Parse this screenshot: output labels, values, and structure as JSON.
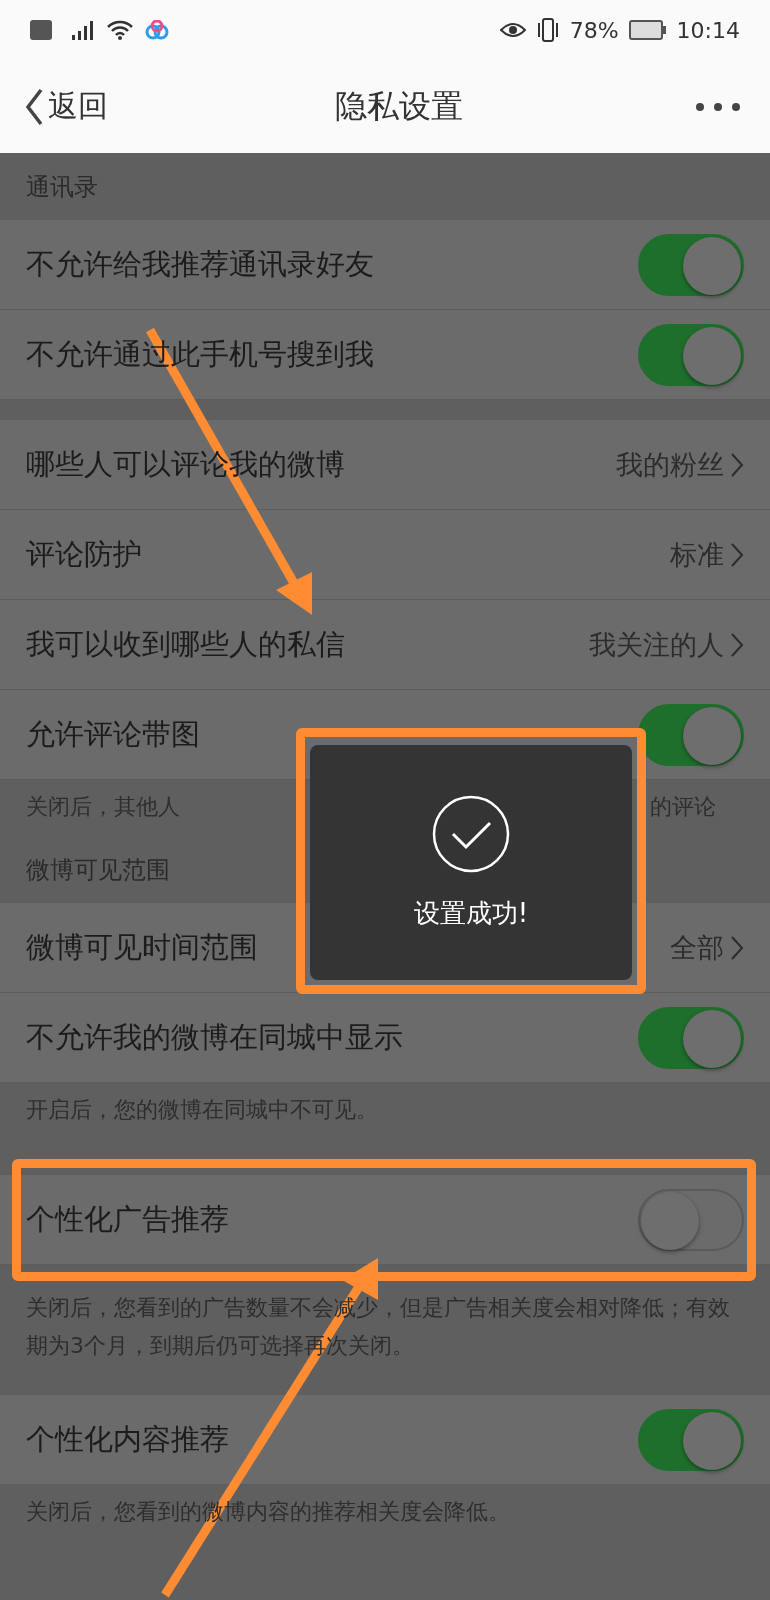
{
  "status_bar": {
    "battery": "78%",
    "time": "10:14"
  },
  "nav": {
    "back": "返回",
    "title": "隐私设置"
  },
  "sections": [
    {
      "header": "通讯录",
      "rows": [
        {
          "kind": "toggle",
          "label": "不允许给我推荐通讯录好友",
          "on": true,
          "highlighted": false
        },
        {
          "kind": "toggle",
          "label": "不允许通过此手机号搜到我",
          "on": true,
          "highlighted": false
        }
      ]
    },
    {
      "rows": [
        {
          "kind": "link",
          "label": "哪些人可以评论我的微博",
          "value": "我的粉丝",
          "highlighted": false
        },
        {
          "kind": "link",
          "label": "评论防护",
          "value": "标准",
          "highlighted": false
        },
        {
          "kind": "link",
          "label": "我可以收到哪些人的私信",
          "value": "我关注的人",
          "highlighted": false
        },
        {
          "kind": "toggle",
          "label": "允许评论带图",
          "on": true,
          "highlighted": false
        }
      ],
      "note_parts": [
        "关闭后，其他人",
        "的评论"
      ]
    },
    {
      "header": "微博可见范围",
      "rows": [
        {
          "kind": "link",
          "label": "微博可见时间范围",
          "value": "全部",
          "highlighted": false
        },
        {
          "kind": "toggle",
          "label": "不允许我的微博在同城中显示",
          "on": true,
          "highlighted": false
        }
      ],
      "note": "开启后，您的微博在同城中不可见。"
    },
    {
      "rows": [
        {
          "kind": "toggle",
          "label": "个性化广告推荐",
          "on": false,
          "highlighted": true
        }
      ],
      "note": "关闭后，您看到的广告数量不会减少，但是广告相关度会相对降低；有效期为3个月，到期后仍可选择再次关闭。"
    },
    {
      "rows": [
        {
          "kind": "toggle",
          "label": "个性化内容推荐",
          "on": true,
          "highlighted": false
        }
      ],
      "note": "关闭后，您看到的微博内容的推荐相关度会降低。"
    }
  ],
  "toast": {
    "message": "设置成功!"
  }
}
